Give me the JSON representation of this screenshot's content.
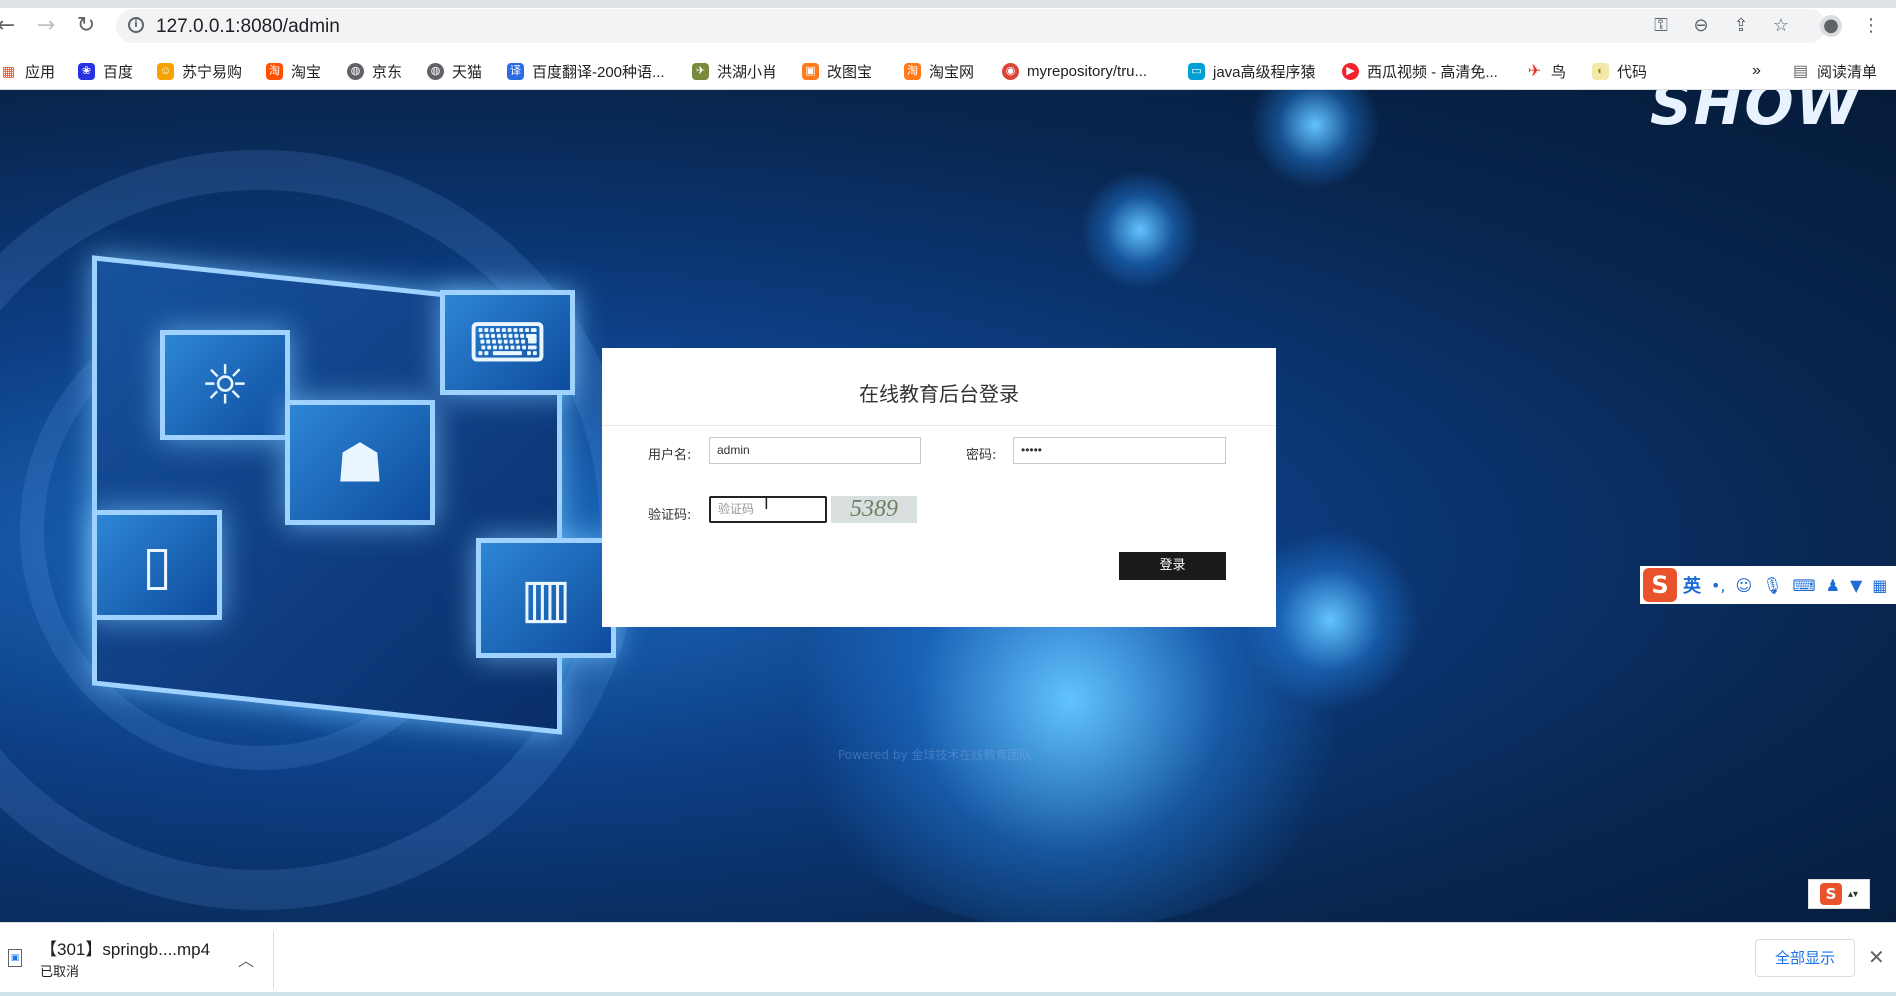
{
  "browser": {
    "url": "127.0.0.1:8080/admin",
    "nav_icons": [
      "back-icon",
      "forward-icon",
      "reload-icon"
    ],
    "omnibox_icons": [
      "key-icon",
      "zoom-out-icon",
      "share-icon",
      "star-icon",
      "profile-icon",
      "menu-icon"
    ]
  },
  "bookmarks": {
    "items": [
      {
        "label": "应用",
        "icon": "apps-grid-icon",
        "color": "#e8532b"
      },
      {
        "label": "百度",
        "icon": "baidu-paw-icon",
        "color": "#2932e1"
      },
      {
        "label": "苏宁易购",
        "icon": "suning-icon",
        "color": "#f5a300"
      },
      {
        "label": "淘宝",
        "icon": "taobao-icon",
        "color": "#ff5000"
      },
      {
        "label": "京东",
        "icon": "globe-icon",
        "color": "#5f6368"
      },
      {
        "label": "天猫",
        "icon": "globe-icon",
        "color": "#5f6368"
      },
      {
        "label": "百度翻译-200种语...",
        "icon": "translate-icon",
        "color": "#2b6de5"
      },
      {
        "label": "洪湖小肖",
        "icon": "bird-icon",
        "color": "#7a8a3c"
      },
      {
        "label": "改图宝",
        "icon": "gaitubao-icon",
        "color": "#ff7a1a"
      },
      {
        "label": "淘宝网",
        "icon": "taobao-icon",
        "color": "#ff7a1a"
      },
      {
        "label": "myrepository/tru...",
        "icon": "chrome-icon",
        "color": "#db4437"
      },
      {
        "label": "java高级程序猿",
        "icon": "bilibili-icon",
        "color": "#00a1d6"
      },
      {
        "label": "西瓜视频 - 高清免...",
        "icon": "xigua-icon",
        "color": "#f5222d"
      },
      {
        "label": "鸟",
        "icon": "bird-red-icon",
        "color": "#e8332b"
      },
      {
        "label": "代码",
        "icon": "folder-icon",
        "color": "#f3e8a8"
      }
    ],
    "overflow": "»",
    "reading_list": "阅读清单"
  },
  "login": {
    "title": "在线教育后台登录",
    "username_label": "用户名:",
    "username_value": "admin",
    "password_label": "密码:",
    "password_value": "•••••",
    "captcha_label": "验证码:",
    "captcha_placeholder": "验证码",
    "captcha_code": "5389",
    "submit_label": "登录"
  },
  "footer_text": "Powered by 金球技术在线教育团队",
  "brand_logo_text": "SHOW",
  "ime": {
    "logo": "S",
    "mode": "英",
    "icons": [
      "punctuation-icon",
      "emoji-icon",
      "mic-icon",
      "keyboard-icon",
      "user-icon",
      "skin-icon",
      "grid-icon"
    ]
  },
  "download": {
    "file_name": "【301】springb....mp4",
    "status": "已取消",
    "show_all": "全部显示",
    "close": "✕"
  }
}
